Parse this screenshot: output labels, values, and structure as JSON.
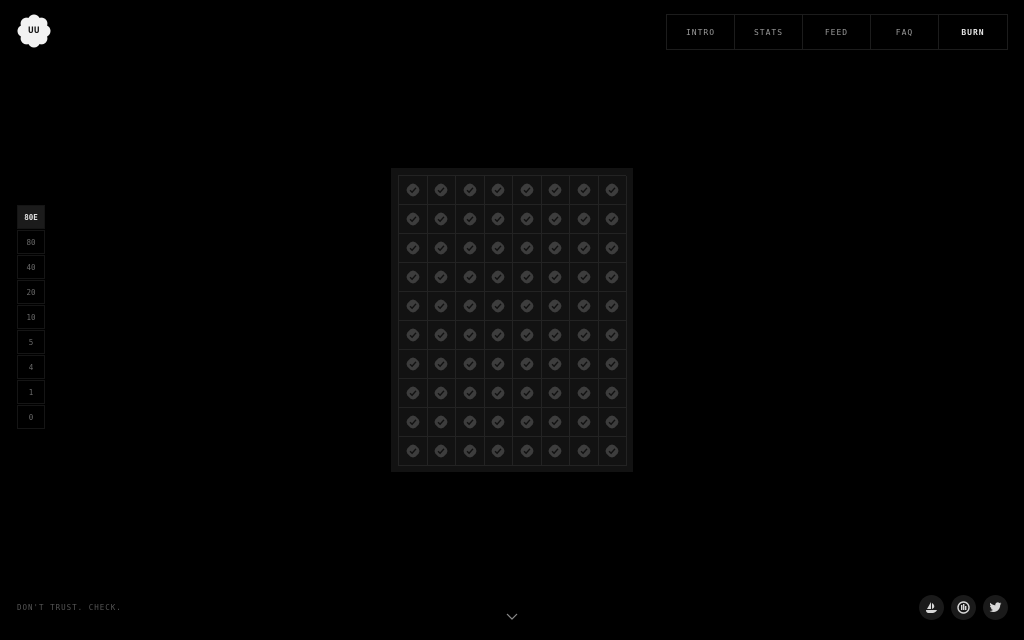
{
  "logo": {
    "text": "UU"
  },
  "nav": {
    "items": [
      {
        "label": "INTRO",
        "active": false
      },
      {
        "label": "STATS",
        "active": false
      },
      {
        "label": "FEED",
        "active": false
      },
      {
        "label": "FAQ",
        "active": false
      },
      {
        "label": "BURN",
        "active": true
      }
    ]
  },
  "levels": {
    "items": [
      {
        "label": "80E",
        "active": true
      },
      {
        "label": "80",
        "active": false
      },
      {
        "label": "40",
        "active": false
      },
      {
        "label": "20",
        "active": false
      },
      {
        "label": "10",
        "active": false
      },
      {
        "label": "5",
        "active": false
      },
      {
        "label": "4",
        "active": false
      },
      {
        "label": "1",
        "active": false
      },
      {
        "label": "0",
        "active": false
      }
    ]
  },
  "grid": {
    "columns": 8,
    "rows": 10,
    "cell_icon": "verified-check-badge-icon",
    "badge_color": "#3d3d3d",
    "check_color": "#111111"
  },
  "footer": {
    "tagline": "DON'T TRUST. CHECK.",
    "scroll_icon": "chevron-down-icon",
    "socials": [
      {
        "name": "opensea",
        "icon": "opensea-icon"
      },
      {
        "name": "looksrare",
        "icon": "marketplace-icon"
      },
      {
        "name": "twitter",
        "icon": "twitter-icon"
      }
    ]
  }
}
